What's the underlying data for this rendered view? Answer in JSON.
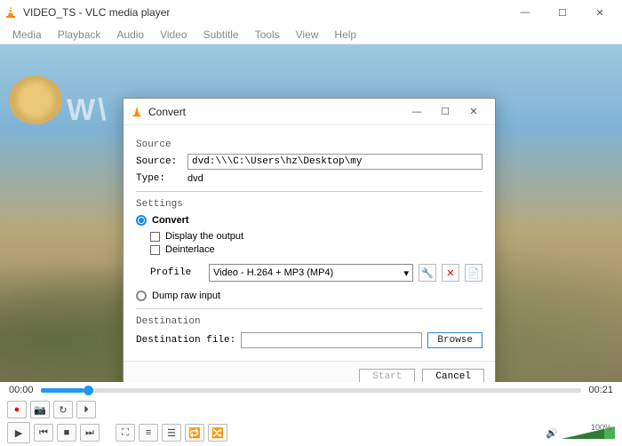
{
  "window": {
    "title": "VIDEO_TS - VLC media player",
    "menus": [
      "Media",
      "Playback",
      "Audio",
      "Video",
      "Subtitle",
      "Tools",
      "View",
      "Help"
    ]
  },
  "player": {
    "time_current": "00:00",
    "time_total": "00:21",
    "volume_pct": "100%"
  },
  "dialog": {
    "title": "Convert",
    "section_source": "Source",
    "source_label": "Source:",
    "source_value": "dvd:\\\\\\C:\\Users\\hz\\Desktop\\my",
    "type_label": "Type:",
    "type_value": "dvd",
    "section_settings": "Settings",
    "opt_convert": "Convert",
    "opt_display": "Display the output",
    "opt_deinterlace": "Deinterlace",
    "profile_label": "Profile",
    "profile_value": "Video - H.264 + MP3 (MP4)",
    "opt_dump": "Dump raw input",
    "section_dest": "Destination",
    "dest_label": "Destination file:",
    "dest_value": "",
    "browse": "Browse",
    "start": "Start",
    "cancel": "Cancel"
  }
}
